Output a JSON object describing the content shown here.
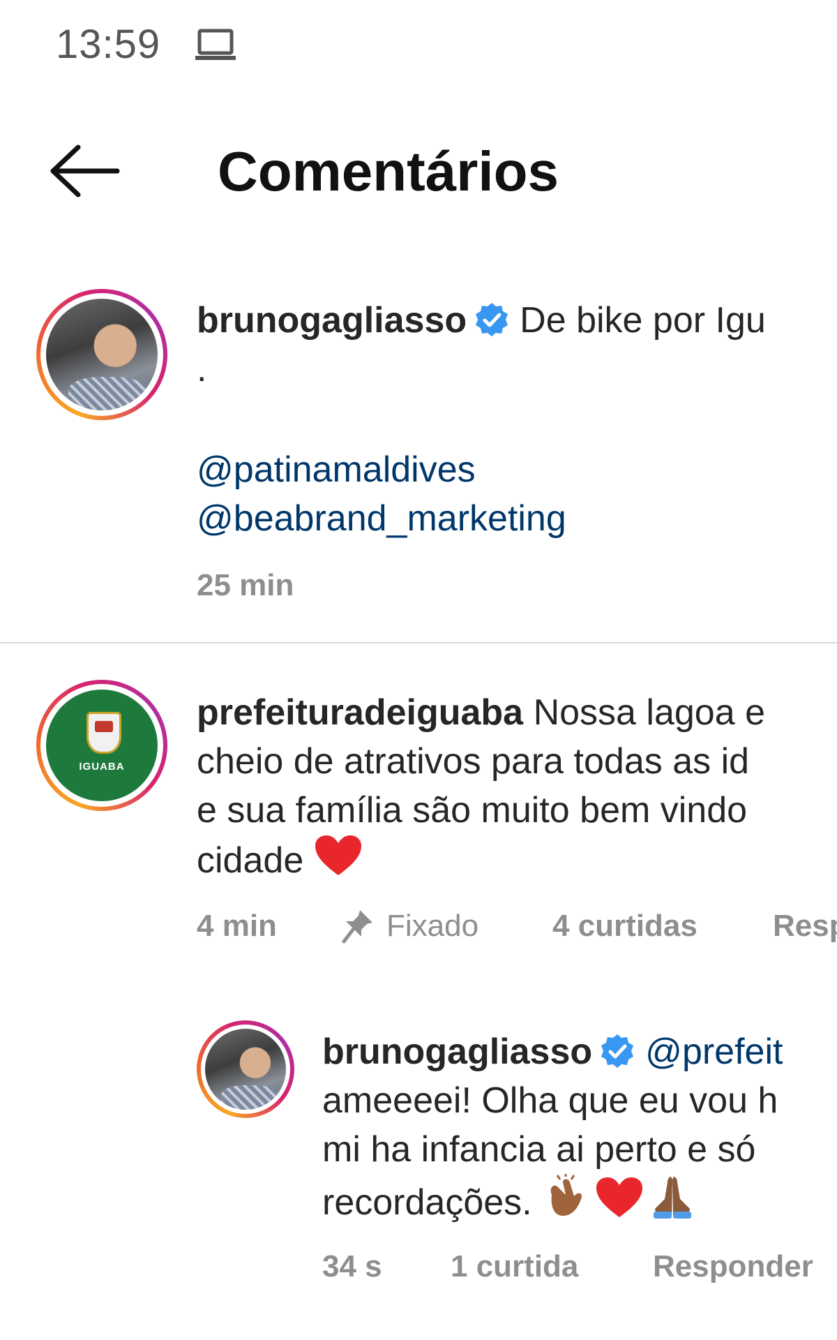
{
  "status_bar": {
    "time": "13:59",
    "icon": "laptop-icon"
  },
  "header": {
    "title": "Comentários",
    "back_icon": "arrow-left-icon"
  },
  "caption": {
    "username": "brunogagliasso",
    "verified": true,
    "text_line1": "De bike por Igu",
    "dot": ".",
    "mention1": "@patinamaldives",
    "mention2": "@beabrand_marketing",
    "time": "25 min"
  },
  "comment": {
    "username": "prefeituradeiguaba",
    "avatar_logo_text": "IGUABA",
    "line1": "Nossa lagoa e",
    "line2": "cheio de atrativos para todas as id",
    "line3": "e sua família são muito bem vindo",
    "line4": "cidade",
    "emoji": "heart-emoji",
    "time": "4 min",
    "pinned_label": "Fixado",
    "likes": "4 curtidas",
    "reply": "Resp"
  },
  "reply_comment": {
    "username": "brunogagliasso",
    "verified": true,
    "mention": "@prefeit",
    "line1": "ameeeei! Olha que eu vou h",
    "line2": "mi ha infancia ai perto e só",
    "line3": "recordações.",
    "emojis": [
      "clapping-hands-emoji",
      "heart-emoji",
      "folded-hands-emoji"
    ],
    "time": "34 s",
    "likes": "1 curtida",
    "reply": "Responder"
  },
  "colors": {
    "verified_blue": "#3897f0",
    "mention_blue": "#00376b",
    "meta_gray": "#8e8e8e",
    "heart_red": "#e8262b"
  }
}
